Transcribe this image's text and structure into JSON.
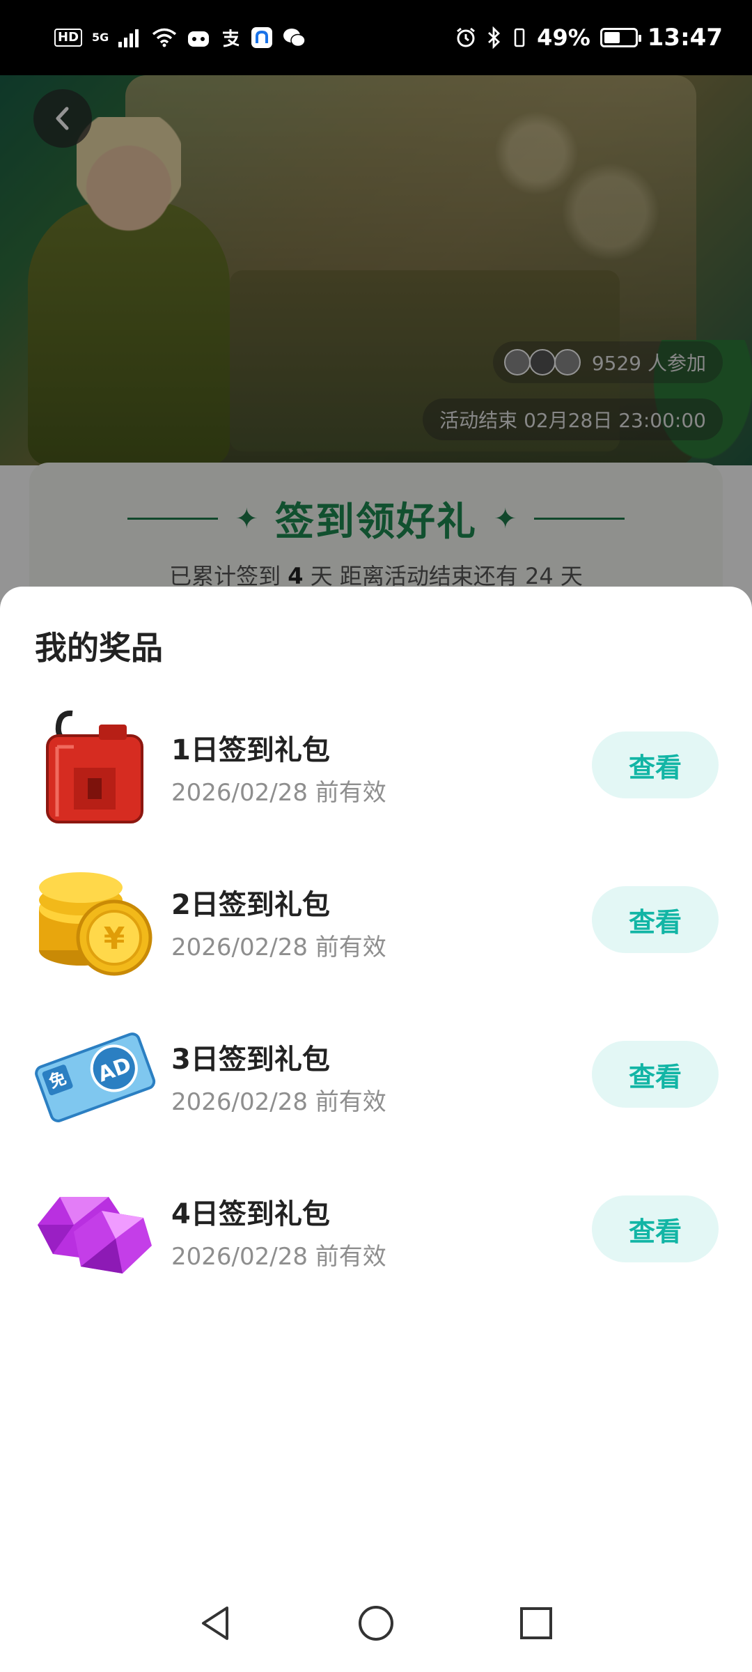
{
  "status_bar": {
    "hd_badge": "HD",
    "network": "5G",
    "battery_pct": "49%",
    "time": "13:47"
  },
  "banner": {
    "participants_count": "9529 人参加",
    "end_time": "活动结束 02月28日 23:00:00"
  },
  "signin": {
    "title": "签到领好礼",
    "summary_prefix": "已累计签到",
    "summary_days": "4",
    "summary_suffix": "天  距离活动结束还有 24 天"
  },
  "sheet": {
    "title": "我的奖品",
    "items": [
      {
        "name": "1日签到礼包",
        "valid": "2026/02/28 前有效",
        "button": "查看",
        "icon": "red-jerry-can-icon"
      },
      {
        "name": "2日签到礼包",
        "valid": "2026/02/28 前有效",
        "button": "查看",
        "icon": "gold-coins-icon"
      },
      {
        "name": "3日签到礼包",
        "valid": "2026/02/28 前有效",
        "button": "查看",
        "icon": "ad-free-ticket-icon"
      },
      {
        "name": "4日签到礼包",
        "valid": "2026/02/28 前有效",
        "button": "查看",
        "icon": "purple-gems-icon"
      }
    ],
    "ad_ticket_badge": "免",
    "ad_ticket_text": "AD"
  },
  "colors": {
    "accent": "#12b5a5",
    "accent_bg": "#e3f7f5",
    "title_green": "#1e8a52"
  }
}
